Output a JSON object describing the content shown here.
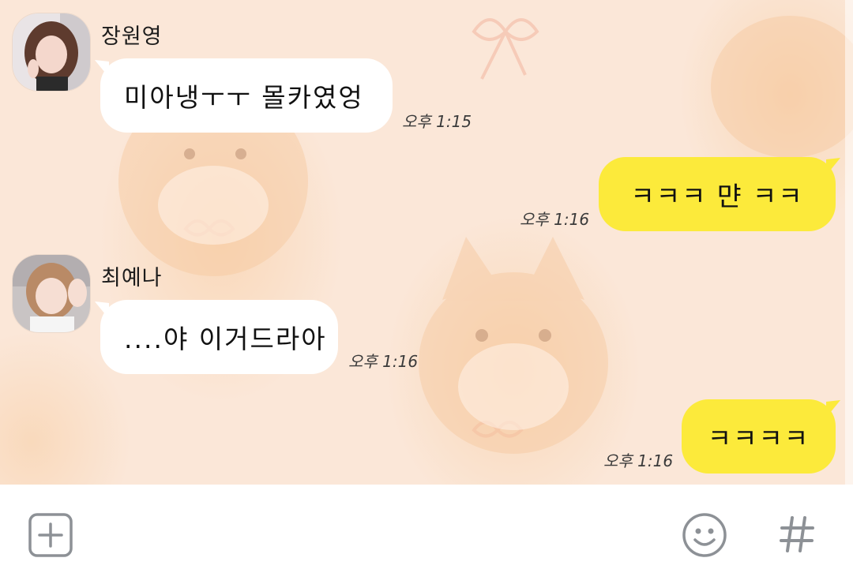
{
  "messages": [
    {
      "sender": "장원영",
      "text": "미아냉ㅜㅜ 몰카였엉",
      "time": "오후 1:15",
      "direction": "incoming"
    },
    {
      "text": "ㅋㅋㅋ 먄 ㅋㅋ",
      "time": "오후 1:16",
      "direction": "outgoing"
    },
    {
      "sender": "최예나",
      "text": "....야 이거드라아",
      "time": "오후 1:16",
      "direction": "incoming"
    },
    {
      "text": "ㅋㅋㅋㅋ",
      "time": "오후 1:16",
      "direction": "outgoing"
    }
  ],
  "input_bar": {
    "left_icon": "plus-square-icon",
    "right_icons": [
      "emoji-icon",
      "hashtag-icon"
    ]
  },
  "colors": {
    "chat_background": "#fbe7d8",
    "outgoing_bubble": "#fcea3b",
    "incoming_bubble": "#ffffff",
    "input_bar": "#ffffff",
    "icon": "#8d9196"
  }
}
